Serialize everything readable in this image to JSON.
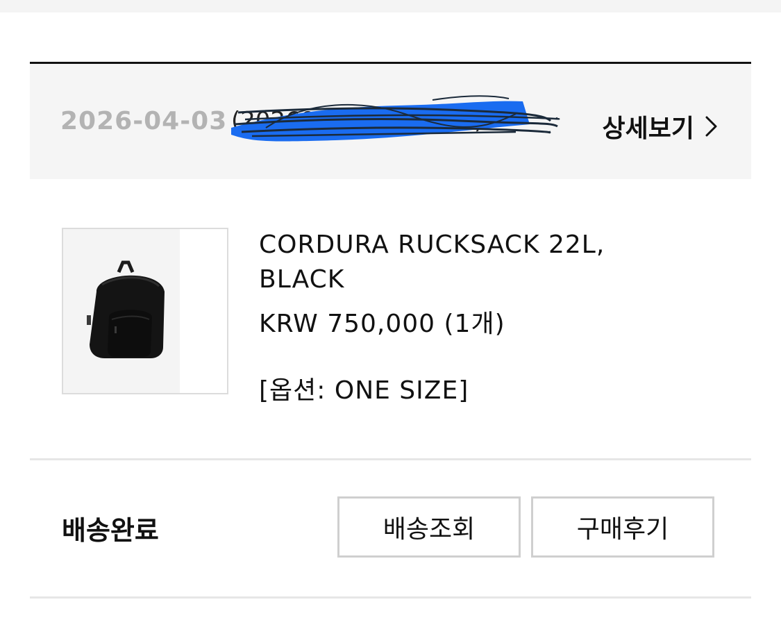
{
  "order": {
    "date": "2026-04-03",
    "order_number": "(20260403-0000000)",
    "detail_label": "상세보기"
  },
  "product": {
    "name_line1": "CORDURA RUCKSACK 22L,",
    "name_line2": "BLACK",
    "price": "KRW 750,000 (1개)",
    "option": "[옵션: ONE SIZE]",
    "image_alt": "CORDURA RUCKSACK 22L, BLACK"
  },
  "status": {
    "label": "배송완료",
    "track_button": "배송조회",
    "review_button": "구매후기"
  },
  "icons": {
    "detail": "chevron-right-icon",
    "redaction": "scribble-redaction"
  },
  "colors": {
    "header_bg": "#f5f5f5",
    "date_text": "#b3b3b3",
    "redaction_blue": "#1a6cf0",
    "top_rule": "#111111"
  }
}
